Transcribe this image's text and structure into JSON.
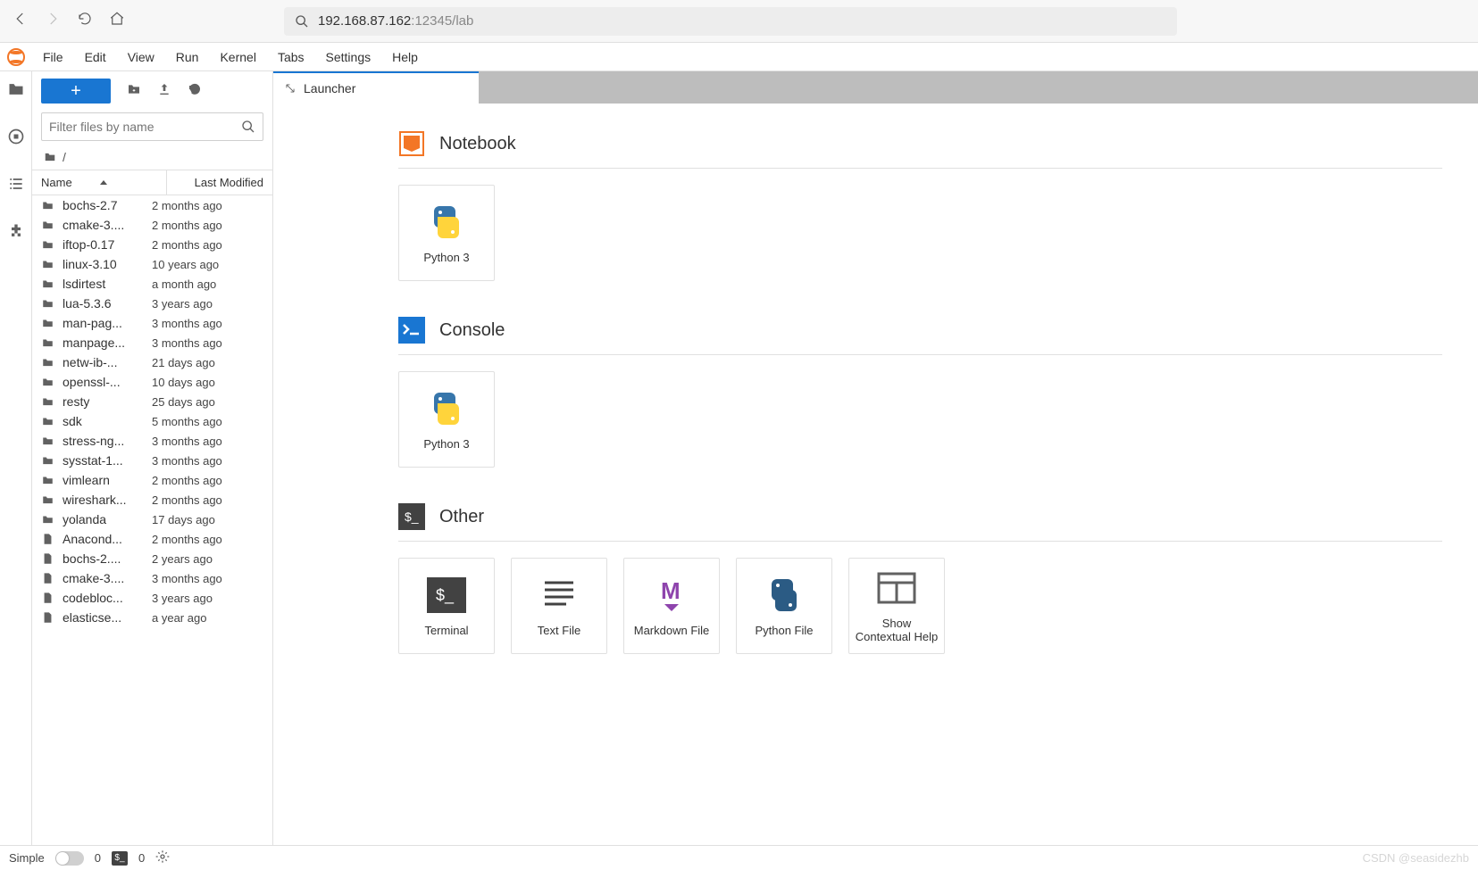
{
  "browser": {
    "address_host": "192.168.87.162",
    "address_suffix": ":12345/lab"
  },
  "menubar": [
    "File",
    "Edit",
    "View",
    "Run",
    "Kernel",
    "Tabs",
    "Settings",
    "Help"
  ],
  "filebrowser": {
    "filter_placeholder": "Filter files by name",
    "breadcrumb": "/",
    "columns": {
      "name": "Name",
      "modified": "Last Modified"
    },
    "items": [
      {
        "type": "folder",
        "name": "bochs-2.7",
        "modified": "2 months ago"
      },
      {
        "type": "folder",
        "name": "cmake-3....",
        "modified": "2 months ago"
      },
      {
        "type": "folder",
        "name": "iftop-0.17",
        "modified": "2 months ago"
      },
      {
        "type": "folder",
        "name": "linux-3.10",
        "modified": "10 years ago"
      },
      {
        "type": "folder",
        "name": "lsdirtest",
        "modified": "a month ago"
      },
      {
        "type": "folder",
        "name": "lua-5.3.6",
        "modified": "3 years ago"
      },
      {
        "type": "folder",
        "name": "man-pag...",
        "modified": "3 months ago"
      },
      {
        "type": "folder",
        "name": "manpage...",
        "modified": "3 months ago"
      },
      {
        "type": "folder",
        "name": "netw-ib-...",
        "modified": "21 days ago"
      },
      {
        "type": "folder",
        "name": "openssl-...",
        "modified": "10 days ago"
      },
      {
        "type": "folder",
        "name": "resty",
        "modified": "25 days ago"
      },
      {
        "type": "folder",
        "name": "sdk",
        "modified": "5 months ago"
      },
      {
        "type": "folder",
        "name": "stress-ng...",
        "modified": "3 months ago"
      },
      {
        "type": "folder",
        "name": "sysstat-1...",
        "modified": "3 months ago"
      },
      {
        "type": "folder",
        "name": "vimlearn",
        "modified": "2 months ago"
      },
      {
        "type": "folder",
        "name": "wireshark...",
        "modified": "2 months ago"
      },
      {
        "type": "folder",
        "name": "yolanda",
        "modified": "17 days ago"
      },
      {
        "type": "file",
        "name": "Anacond...",
        "modified": "2 months ago"
      },
      {
        "type": "file",
        "name": "bochs-2....",
        "modified": "2 years ago"
      },
      {
        "type": "file",
        "name": "cmake-3....",
        "modified": "3 months ago"
      },
      {
        "type": "file",
        "name": "codebloc...",
        "modified": "3 years ago"
      },
      {
        "type": "file",
        "name": "elasticse...",
        "modified": "a year ago"
      }
    ]
  },
  "tab": {
    "title": "Launcher"
  },
  "launcher": {
    "sections": [
      {
        "title": "Notebook",
        "badge": "notebook",
        "cards": [
          {
            "icon": "python",
            "label": "Python 3"
          }
        ]
      },
      {
        "title": "Console",
        "badge": "console",
        "cards": [
          {
            "icon": "python",
            "label": "Python 3"
          }
        ]
      },
      {
        "title": "Other",
        "badge": "terminal",
        "cards": [
          {
            "icon": "terminal",
            "label": "Terminal"
          },
          {
            "icon": "textfile",
            "label": "Text File"
          },
          {
            "icon": "markdown",
            "label": "Markdown File"
          },
          {
            "icon": "pyfile",
            "label": "Python File"
          },
          {
            "icon": "contextual",
            "label": "Show Contextual Help"
          }
        ]
      }
    ]
  },
  "statusbar": {
    "simple_label": "Simple",
    "count1": "0",
    "count2": "0"
  },
  "watermark": "CSDN @seasidezhb"
}
